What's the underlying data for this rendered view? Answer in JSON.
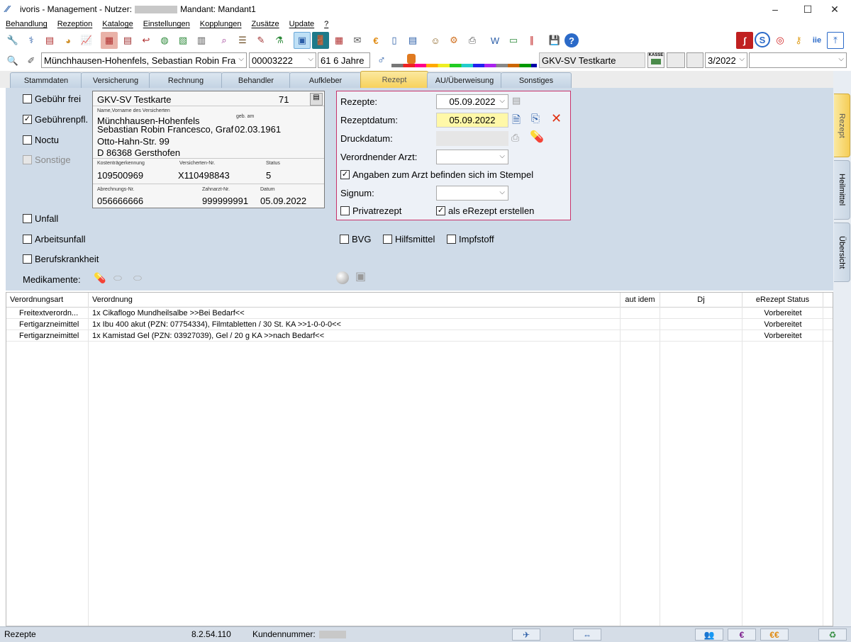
{
  "window": {
    "title_prefix": "ivoris - Management - Nutzer:",
    "title_suffix": "Mandant: Mandant1",
    "minimize": "–",
    "maximize": "☐",
    "close": "✕"
  },
  "menu": [
    "Behandlung",
    "Rezeption",
    "Kataloge",
    "Einstellungen",
    "Kopplungen",
    "Zusätze",
    "Update",
    "?"
  ],
  "patient": {
    "name": "Münchhausen-Hohenfels, Sebastian Robin Fra",
    "number": "00003222",
    "age": "61 6 Jahre",
    "card": "GKV-SV Testkarte",
    "kasse_label": "KASSE",
    "quarter": "3/2022",
    "extra": ""
  },
  "tabs": [
    "Stammdaten",
    "Versicherung",
    "Rechnung",
    "Behandler",
    "Aufkleber",
    "Rezept",
    "AU/Überweisung",
    "Sonstiges"
  ],
  "side_tabs": [
    "Rezept",
    "Heilmittel",
    "Übersicht"
  ],
  "checks_left": {
    "gebuehr_frei": "Gebühr frei",
    "gebuehrenpfl": "Gebührenpfl.",
    "noctu": "Noctu",
    "sonstige": "Sonstige",
    "unfall": "Unfall",
    "arbeitsunfall": "Arbeitsunfall",
    "berufskrankheit": "Berufskrankheit"
  },
  "medikamente_label": "Medikamente:",
  "card": {
    "title": "GKV-SV Testkarte",
    "code": "71",
    "name_label": "Name,Vorname des Versicherten",
    "geb_label": "geb. am",
    "lastname": "Münchhausen-Hohenfels",
    "firstname": "Sebastian Robin Francesco, Graf",
    "birth": "02.03.1961",
    "street": "Otto-Hahn-Str. 99",
    "city": "D 86368 Gersthofen",
    "kt_label": "Kostenträgerkennung",
    "vers_label": "Versicherten-Nr.",
    "status_label": "Status",
    "kt": "109500969",
    "vers": "X110498843",
    "status": "5",
    "abr_label": "Abrechnungs-Nr.",
    "zahn_label": "Zahnarzt-Nr.",
    "datum_label": "Datum",
    "abr": "056666666",
    "zahn": "999999991",
    "datum": "05.09.2022"
  },
  "rezept": {
    "rezepte_label": "Rezepte:",
    "rezepte_value": "05.09.2022",
    "rezeptdatum_label": "Rezeptdatum:",
    "rezeptdatum_value": "05.09.2022",
    "druckdatum_label": "Druckdatum:",
    "arzt_label": "Verordnender Arzt:",
    "stempel_label": "Angaben zum Arzt befinden sich im Stempel",
    "signum_label": "Signum:",
    "privat_label": "Privatrezept",
    "erezept_label": "als eRezept erstellen"
  },
  "checks_mid": {
    "bvg": "BVG",
    "hilfsmittel": "Hilfsmittel",
    "impfstoff": "Impfstoff"
  },
  "table": {
    "headers": [
      "Verordnungsart",
      "Verordnung",
      "aut idem",
      "Dj",
      "eRezept Status"
    ],
    "rows": [
      {
        "art": "Freitextverordn...",
        "text": "1x Cikaflogo Mundheilsalbe >>Bei Bedarf<<",
        "autidem": "",
        "dj": "",
        "status": "Vorbereitet"
      },
      {
        "art": "Fertigarzneimittel",
        "text": "1x Ibu 400 akut (PZN: 07754334), Filmtabletten / 30 St. KA >>1-0-0-0<<",
        "autidem": "",
        "dj": "",
        "status": "Vorbereitet"
      },
      {
        "art": "Fertigarzneimittel",
        "text": "1x Kamistad Gel (PZN: 03927039), Gel / 20 g KA >>nach Bedarf<<",
        "autidem": "",
        "dj": "",
        "status": "Vorbereitet"
      }
    ]
  },
  "status": {
    "section": "Rezepte",
    "version": "8.2.54.110",
    "kunden_label": "Kundennummer:"
  },
  "colors": {
    "panel": "#cfdbe8",
    "active_tab": "#f7d25c",
    "rezept_border": "#c8336a",
    "highlight_date": "#fff8a8"
  }
}
